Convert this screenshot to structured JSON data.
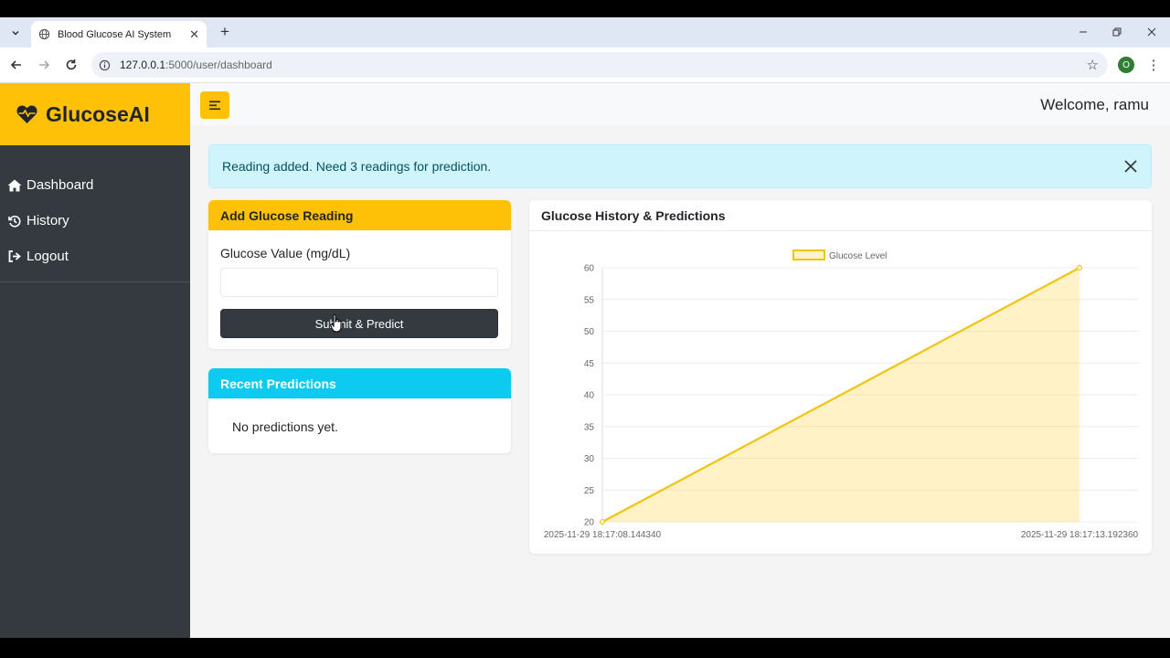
{
  "browser": {
    "tab_title": "Blood Glucose AI System",
    "url_host": "127.0.0.1",
    "url_rest": ":5000/user/dashboard",
    "profile_initial": "O"
  },
  "sidebar": {
    "brand": "GlucoseAI",
    "items": [
      {
        "label": "Dashboard",
        "icon": "home-icon"
      },
      {
        "label": "History",
        "icon": "history-icon"
      },
      {
        "label": "Logout",
        "icon": "logout-icon"
      }
    ]
  },
  "topbar": {
    "welcome": "Welcome, ramu"
  },
  "alert": {
    "message": "Reading added. Need 3 readings for prediction."
  },
  "add_reading": {
    "title": "Add Glucose Reading",
    "field_label": "Glucose Value (mg/dL)",
    "value": "",
    "submit_label": "Submit & Predict"
  },
  "recent": {
    "title": "Recent Predictions",
    "empty_text": "No predictions yet."
  },
  "chart_card": {
    "title": "Glucose History & Predictions"
  },
  "colors": {
    "brand": "#ffc107",
    "sidebar": "#343a40",
    "info": "#0dcaf0",
    "alert_bg": "#cff4fc",
    "series_line": "#f1c40f"
  },
  "chart_data": {
    "type": "area",
    "x": [
      "2025-11-29 18:17:08.144340",
      "2025-11-29 18:17:13.192360"
    ],
    "series": [
      {
        "name": "Glucose Level",
        "values": [
          20,
          60
        ]
      }
    ],
    "yticks": [
      20,
      25,
      30,
      35,
      40,
      45,
      50,
      55,
      60
    ],
    "ylim": [
      20,
      60
    ],
    "legend": "top-center",
    "grid": true
  }
}
